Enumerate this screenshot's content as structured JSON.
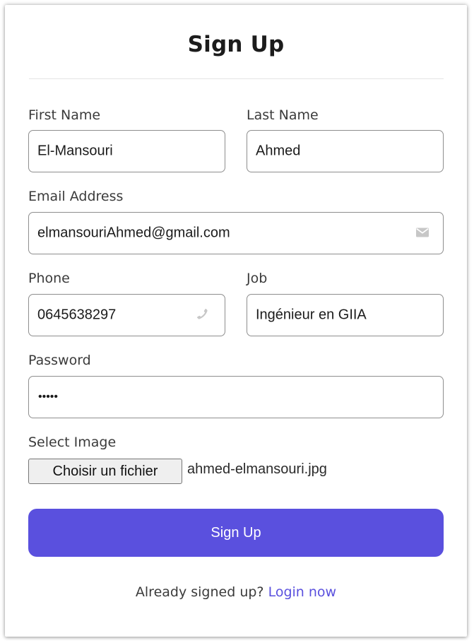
{
  "form": {
    "title": "Sign Up",
    "first_name": {
      "label": "First Name",
      "value": "El-Mansouri"
    },
    "last_name": {
      "label": "Last Name",
      "value": "Ahmed"
    },
    "email": {
      "label": "Email Address",
      "value": "elmansouriAhmed@gmail.com",
      "icon": "envelope-icon"
    },
    "phone": {
      "label": "Phone",
      "value": "0645638297",
      "icon": "phone-icon"
    },
    "job": {
      "label": "Job",
      "value": "Ingénieur en GIIA"
    },
    "password": {
      "label": "Password",
      "masked_value": "•••••"
    },
    "image": {
      "label": "Select Image",
      "button_label": "Choisir un fichier",
      "file_name": "ahmed-elmansouri.jpg"
    },
    "submit_label": "Sign Up",
    "footer": {
      "text": "Already signed up?",
      "link_label": "Login now"
    }
  },
  "colors": {
    "accent": "#5a50de",
    "border": "#8e8e8e",
    "icon": "#c7c7c7"
  }
}
